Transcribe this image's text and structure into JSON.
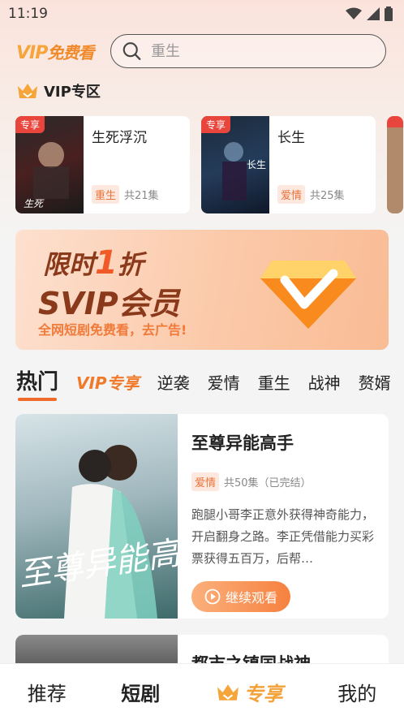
{
  "status_bar": {
    "time": "11:19"
  },
  "header": {
    "logo_vip": "VIP",
    "logo_text": "免费看",
    "search_placeholder": "重生"
  },
  "vip_section": {
    "title": "VIP专区",
    "cards": [
      {
        "tag": "专享",
        "title": "生死浮沉",
        "genre": "重生",
        "episodes": "共21集"
      },
      {
        "tag": "专享",
        "title": "长生",
        "genre": "爱情",
        "episodes": "共25集"
      }
    ]
  },
  "banner": {
    "line1_prefix": "限时",
    "line1_num": "1",
    "line1_suffix": "折",
    "line2": "SVIP会员",
    "line3": "全网短剧免费看，去广告!"
  },
  "tabs": [
    {
      "label": "热门"
    },
    {
      "label": "VIP专享"
    },
    {
      "label": "逆袭"
    },
    {
      "label": "爱情"
    },
    {
      "label": "重生"
    },
    {
      "label": "战神"
    },
    {
      "label": "赘婿"
    }
  ],
  "dramas": [
    {
      "title": "至尊异能高手",
      "genre": "爱情",
      "episodes": "共50集（已完结）",
      "description": "跑腿小哥李正意外获得神奇能力，开启翻身之路。李正凭借能力买彩票获得五百万，后帮…",
      "play_label": "继续观看",
      "poster_text": "至尊异能高手"
    },
    {
      "title": "都市之镇国战神"
    }
  ],
  "bottom_nav": [
    {
      "label": "推荐"
    },
    {
      "label": "短剧"
    },
    {
      "label": "专享"
    },
    {
      "label": "我的"
    }
  ],
  "colors": {
    "accent": "#f06b2a",
    "tag_red": "#e8453c",
    "vip_gold": "#f3a23a"
  }
}
